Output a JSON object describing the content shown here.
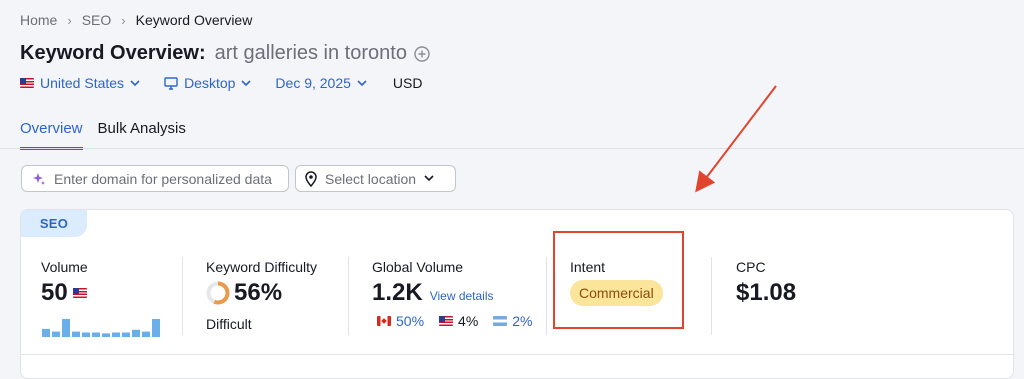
{
  "breadcrumb": {
    "items": [
      "Home",
      "SEO",
      "Keyword Overview"
    ]
  },
  "title": {
    "prefix": "Keyword Overview:",
    "keyword": "art galleries in toronto"
  },
  "filters": {
    "country": "United States",
    "device": "Desktop",
    "date": "Dec 9, 2025",
    "currency": "USD"
  },
  "tabs": [
    "Overview",
    "Bulk Analysis"
  ],
  "domain_input": {
    "placeholder": "Enter domain for personalized data"
  },
  "location_select": {
    "label": "Select location"
  },
  "card": {
    "tag": "SEO",
    "volume": {
      "label": "Volume",
      "value": "50",
      "trend": [
        0.45,
        0.3,
        1.0,
        0.3,
        0.25,
        0.25,
        0.2,
        0.25,
        0.25,
        0.4,
        0.3,
        1.0
      ]
    },
    "difficulty": {
      "label": "Keyword Difficulty",
      "value": "56%",
      "level": "Difficult",
      "percent": 56
    },
    "global_volume": {
      "label": "Global Volume",
      "value": "1.2K",
      "link": "View details",
      "countries": [
        {
          "flag": "flag-ca-icon",
          "percent": "50%"
        },
        {
          "flag": "flag-us-icon",
          "percent": "4%"
        },
        {
          "flag": "flag-ar-icon",
          "percent": "2%"
        }
      ]
    },
    "intent": {
      "label": "Intent",
      "value": "Commercial"
    },
    "cpc": {
      "label": "CPC",
      "value": "$1.08"
    }
  },
  "colors": {
    "accent": "#2e65c7",
    "annotation": "#e0452e",
    "intent_badge": "#fbe59a",
    "spark": "#6aaeea",
    "difficulty_ring": "#e99a4b"
  }
}
